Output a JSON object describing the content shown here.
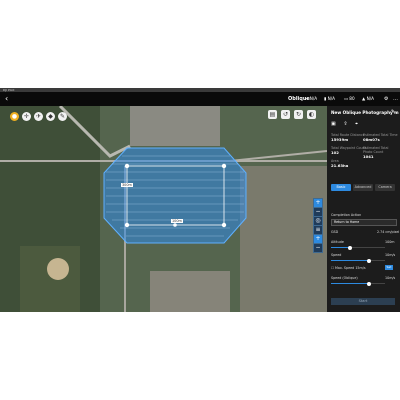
{
  "os": {
    "title": "DJI Pilot"
  },
  "topbar": {
    "back": "‹",
    "mode": "Oblique",
    "gps": "N/A",
    "rc": "N/A",
    "battery": "80",
    "signal": "N/A",
    "settings": "⚙",
    "more": "…"
  },
  "map": {
    "scale_label": "100m",
    "side_label": "300m"
  },
  "toolbar_icons": [
    "pin-icon",
    "crosshair-icon",
    "drone-icon",
    "waypoint-icon",
    "edit-icon"
  ],
  "panel": {
    "title": "New Oblique Photography m",
    "stats": [
      {
        "label": "Total Route Distance",
        "value": "15939m"
      },
      {
        "label": "Estimated Total Time",
        "value": "08m07s"
      },
      {
        "label": "Total Waypoint Count",
        "value": "102"
      },
      {
        "label": "Estimated Total Photo Count",
        "value": "1041"
      },
      {
        "label": "Area",
        "value": "21.63ha"
      }
    ],
    "tabs": [
      "Basic",
      "Advanced",
      "Camera"
    ],
    "completion_label": "Completion Action",
    "completion_value": "Return to Home",
    "gsd_label": "GSD",
    "gsd_value": "2.74 cm/pixel",
    "altitude_label": "Altitude",
    "altitude_value": "100m",
    "altitude_level": 0.35,
    "speed_label": "Speed",
    "speed_value": "10m/s",
    "speed_level": 0.7,
    "max_speed_label": "Max. Speed",
    "max_speed_value": "15m/s",
    "set_label": "Set",
    "oblique_speed_label": "Speed (Oblique)",
    "oblique_speed_value": "10m/s",
    "oblique_speed_level": 0.7,
    "start_label": "Start"
  }
}
